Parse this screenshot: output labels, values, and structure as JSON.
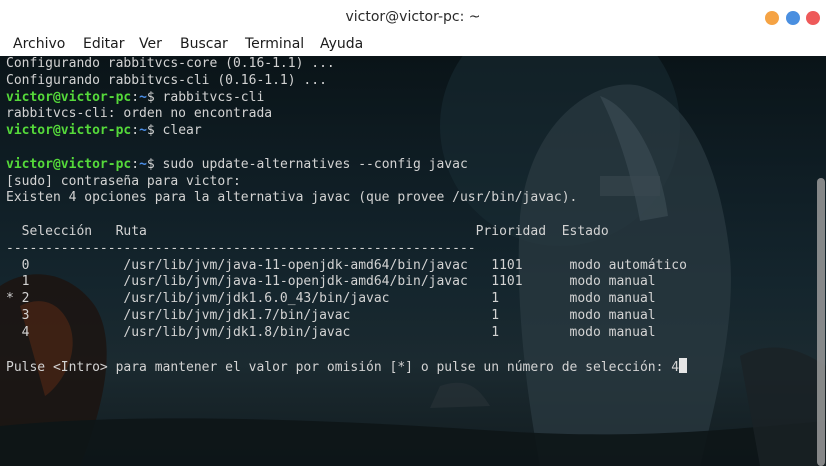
{
  "window": {
    "title": "victor@victor-pc: ~",
    "buttons": {
      "minimize_color": "#f5a344",
      "maximize_color": "#4a8fe0",
      "close_color": "#ee5a5a"
    }
  },
  "menubar": {
    "items": [
      "Archivo",
      "Editar",
      "Ver",
      "Buscar",
      "Terminal",
      "Ayuda"
    ]
  },
  "terminal": {
    "user": "victor@victor-pc",
    "path": "~",
    "lines": [
      {
        "text": "Configurando rabbitvcs-core (0.16-1.1) ..."
      },
      {
        "text": "Configurando rabbitvcs-cli (0.16-1.1) ..."
      },
      {
        "prompt": true,
        "cmd": " rabbitvcs-cli"
      },
      {
        "text": "rabbitvcs-cli: orden no encontrada"
      },
      {
        "prompt": true,
        "cmd": " clear"
      },
      {
        "text": ""
      },
      {
        "prompt": true,
        "cmd": " sudo update-alternatives --config javac"
      },
      {
        "text": "[sudo] contraseña para victor:"
      },
      {
        "text": "Existen 4 opciones para la alternativa javac (que provee /usr/bin/javac)."
      },
      {
        "text": ""
      },
      {
        "text": "  Selección   Ruta                                          Prioridad  Estado"
      },
      {
        "text": "------------------------------------------------------------"
      },
      {
        "text": "  0            /usr/lib/jvm/java-11-openjdk-amd64/bin/javac   1101      modo automático"
      },
      {
        "text": "  1            /usr/lib/jvm/java-11-openjdk-amd64/bin/javac   1101      modo manual"
      },
      {
        "text": "* 2            /usr/lib/jvm/jdk1.6.0_43/bin/javac             1         modo manual"
      },
      {
        "text": "  3            /usr/lib/jvm/jdk1.7/bin/javac                  1         modo manual"
      },
      {
        "text": "  4            /usr/lib/jvm/jdk1.8/bin/javac                  1         modo manual"
      },
      {
        "text": ""
      },
      {
        "text": "Pulse <Intro> para mantener el valor por omisión [*] o pulse un número de selección: 4",
        "cursor": true
      }
    ]
  }
}
